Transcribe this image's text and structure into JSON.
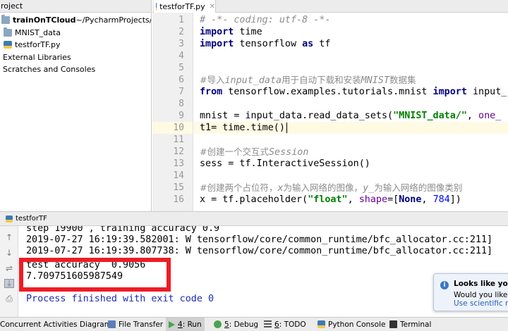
{
  "project_panel": {
    "header": "roject",
    "items": [
      {
        "label": "trainOnTCloud",
        "path": " ~/PycharmProjects/trainOnTC",
        "bold": true,
        "icon": "folder-icon"
      },
      {
        "label": "MNIST_data",
        "icon": "folder-icon"
      },
      {
        "label": "testforTF.py",
        "icon": "python-file-icon"
      },
      {
        "label": "External Libraries",
        "icon": "library-icon"
      },
      {
        "label": "Scratches and Consoles",
        "icon": "scratches-icon"
      }
    ]
  },
  "editor": {
    "tab": "testforTF.py",
    "current_line": 10,
    "lines": [
      {
        "n": "1"
      },
      {
        "n": "2"
      },
      {
        "n": "3"
      },
      {
        "n": "4"
      },
      {
        "n": "5"
      },
      {
        "n": "6"
      },
      {
        "n": "7"
      },
      {
        "n": "8"
      },
      {
        "n": "9"
      },
      {
        "n": "10"
      },
      {
        "n": "11"
      },
      {
        "n": "12"
      },
      {
        "n": "13"
      },
      {
        "n": "14"
      },
      {
        "n": "15"
      },
      {
        "n": "16"
      }
    ],
    "code": {
      "l1": "# -*- coding: utf-8 -*-",
      "l2_kw": "import",
      "l2_rest": " time",
      "l3_kw": "import",
      "l3_mod": " tensorflow ",
      "l3_as": "as",
      "l3_alias": " tf",
      "l5_cm": "#导入",
      "l5_cm_it": "input_data",
      "l5_cm2": "用于自动下载和安装",
      "l5_cm_it2": "MNIST",
      "l5_cm3": "数据集",
      "l6_from": "from",
      "l6_mod": " tensorflow.examples.tutorials.mnist ",
      "l6_import": "import",
      "l6_rest": " input_",
      "l8_pre": "mnist = input_data.read_data_sets(",
      "l8_str": "\"MNIST_data/\"",
      "l8_post": ", ",
      "l8_kwarg": "one_",
      "l10": "t1= time.time()",
      "l12_cm": "#创建一个交互式",
      "l12_cm_it": "Session",
      "l13": "sess = tf.InteractiveSession()",
      "l15_cm": "#创建两个占位符，",
      "l15_x": "x",
      "l15_cm2": "为输入网络的图像，",
      "l15_y": "y_",
      "l15_cm3": "为输入网络的图像类别",
      "l16_pre": "x = tf.placeholder(",
      "l16_str": "\"float\"",
      "l16_mid": ", ",
      "l16_kwarg": "shape",
      "l16_eq": "=[",
      "l16_none": "None",
      "l16_comma": ", ",
      "l16_num": "784",
      "l16_end": "])"
    }
  },
  "run_panel": {
    "tab": "testforTF",
    "lines": {
      "step": "step 19900 , training accuracy 0.9",
      "warn1": "2019-07-27 16:19:39.582001: W tensorflow/core/common_runtime/bfc_allocator.cc:211]",
      "warn2": "2019-07-27 16:19:39.807738: W tensorflow/core/common_runtime/bfc_allocator.cc:211]",
      "accuracy": "test accuracy  0.9056",
      "elapsed": "7.709751605987549",
      "exit": "Process finished with exit code 0"
    },
    "toolbar_icons": [
      "up-arrow-icon",
      "down-arrow-icon",
      "soft-wrap-icon",
      "scroll-to-end-icon",
      "print-icon"
    ]
  },
  "notification": {
    "title": "Looks like you're",
    "line2": "Would you like to",
    "link": "Use scientific mo"
  },
  "statusbar": {
    "items": [
      {
        "label": "Concurrent Activities Diagram"
      },
      {
        "label": "File Transfer",
        "icon": "file-transfer-icon"
      },
      {
        "key": "4",
        "label": ": Run",
        "icon": "run-icon",
        "active": true
      },
      {
        "key": "5",
        "label": ": Debug",
        "icon": "debug-icon"
      },
      {
        "key": "6",
        "label": ": TODO",
        "icon": "todo-icon"
      },
      {
        "label": "Python Console",
        "icon": "python-console-icon"
      },
      {
        "label": "Terminal",
        "icon": "terminal-icon"
      }
    ]
  },
  "colors": {
    "highlight_box": "#ee1c24",
    "keyword": "#000080",
    "string": "#008000",
    "comment": "#8c8c8c",
    "console_blue": "#1e2bb5"
  }
}
